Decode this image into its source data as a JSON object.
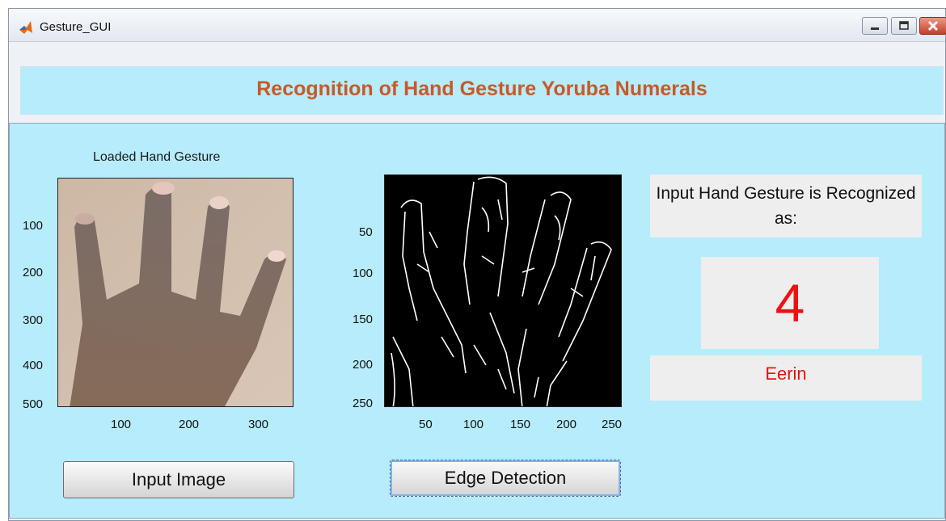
{
  "window": {
    "title": "Gesture_GUI"
  },
  "header": {
    "title": "Recognition of Hand Gesture Yoruba Numerals"
  },
  "loaded_axes": {
    "title": "Loaded Hand Gesture",
    "y_ticks": [
      "100",
      "200",
      "300",
      "400",
      "500"
    ],
    "x_ticks": [
      "100",
      "200",
      "300"
    ]
  },
  "edge_axes": {
    "y_ticks": [
      "50",
      "100",
      "150",
      "200",
      "250"
    ],
    "x_ticks": [
      "50",
      "100",
      "150",
      "200",
      "250"
    ]
  },
  "buttons": {
    "input_image": "Input Image",
    "edge_detection": "Edge Detection"
  },
  "result": {
    "label": "Input Hand Gesture is Recognized as:",
    "digit": "4",
    "word": "Eerin",
    "digit_color": "#ee1111"
  },
  "colors": {
    "panel": "#b6ecfb",
    "title": "#c65a28"
  }
}
